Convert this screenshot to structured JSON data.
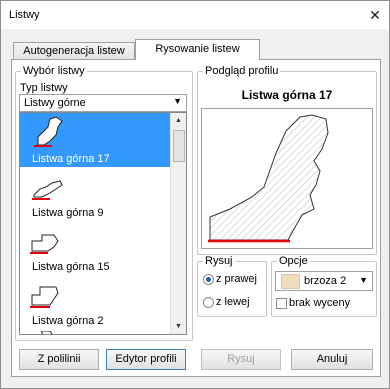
{
  "window": {
    "title": "Listwy"
  },
  "tabs": [
    {
      "label": "Autogeneracja listew"
    },
    {
      "label": "Rysowanie listew"
    }
  ],
  "left_group": {
    "legend": "Wybór listwy",
    "type_label": "Typ listwy",
    "type_value": "Listwy górne",
    "items": [
      {
        "label": "Listwa górna 17",
        "selected": true
      },
      {
        "label": "Listwa górna 9",
        "selected": false
      },
      {
        "label": "Listwa górna 15",
        "selected": false
      },
      {
        "label": "Listwa górna 2",
        "selected": false
      }
    ]
  },
  "preview_group": {
    "legend": "Podgląd profilu",
    "title": "Listwa górna 17"
  },
  "draw_group": {
    "legend": "Rysuj",
    "options": [
      {
        "label": "z prawej",
        "checked": true
      },
      {
        "label": "z lewej",
        "checked": false
      }
    ]
  },
  "options_group": {
    "legend": "Opcje",
    "material": "brzoza 2",
    "no_price_label": "brak wyceny",
    "no_price_checked": false
  },
  "buttons": {
    "from_polyline": "Z polilinii",
    "profile_editor": "Edytor profili",
    "draw": "Rysuj",
    "cancel": "Anuluj"
  },
  "colors": {
    "selection": "#3399ff",
    "profile_base": "#e0000a",
    "swatch": "#efdcbf"
  }
}
